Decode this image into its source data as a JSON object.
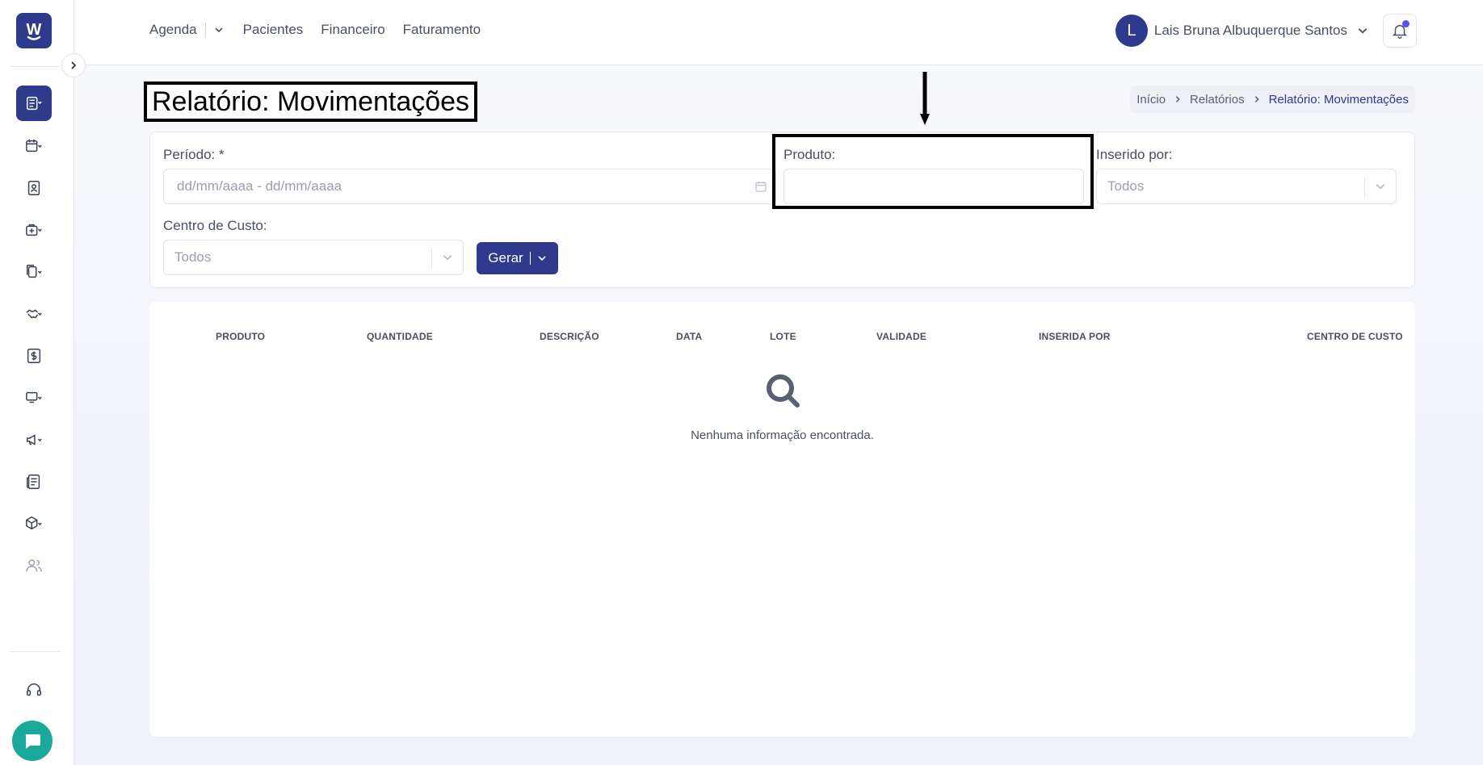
{
  "app": {
    "logo_letter": "W",
    "brand_color": "#2e3a8c",
    "accent_dot": "#5b4ff0",
    "chat_color": "#19a89a"
  },
  "sidebar": {
    "items": [
      {
        "icon": "report-book-icon",
        "active": true
      },
      {
        "icon": "calendar-icon"
      },
      {
        "icon": "patient-id-icon"
      },
      {
        "icon": "medical-case-icon"
      },
      {
        "icon": "documents-icon"
      },
      {
        "icon": "handshake-icon"
      },
      {
        "icon": "dollar-icon"
      },
      {
        "icon": "monitor-icon"
      },
      {
        "icon": "megaphone-icon"
      },
      {
        "icon": "newspaper-icon"
      },
      {
        "icon": "package-icon"
      },
      {
        "icon": "users-icon"
      }
    ],
    "support_icon": "headset-icon",
    "chat_icon": "chat-icon"
  },
  "topnav": {
    "items": [
      "Agenda",
      "Pacientes",
      "Financeiro",
      "Faturamento"
    ],
    "user_initial": "L",
    "user_name": "Lais Bruna Albuquerque Santos"
  },
  "page": {
    "title": "Relatório: Movimentações",
    "breadcrumb": [
      "Início",
      "Relatórios",
      "Relatório: Movimentações"
    ]
  },
  "filters": {
    "periodo_label": "Período: *",
    "periodo_placeholder": "dd/mm/aaaa - dd/mm/aaaa",
    "produto_label": "Produto:",
    "produto_value": "",
    "inserido_label": "Inserido por:",
    "inserido_value": "Todos",
    "centro_label": "Centro de Custo:",
    "centro_value": "Todos",
    "gerar_label": "Gerar"
  },
  "table": {
    "columns": [
      "PRODUTO",
      "QUANTIDADE",
      "DESCRIÇÃO",
      "DATA",
      "LOTE",
      "VALIDADE",
      "INSERIDA POR",
      "CENTRO DE CUSTO"
    ],
    "rows": [],
    "empty_text": "Nenhuma informação encontrada."
  }
}
